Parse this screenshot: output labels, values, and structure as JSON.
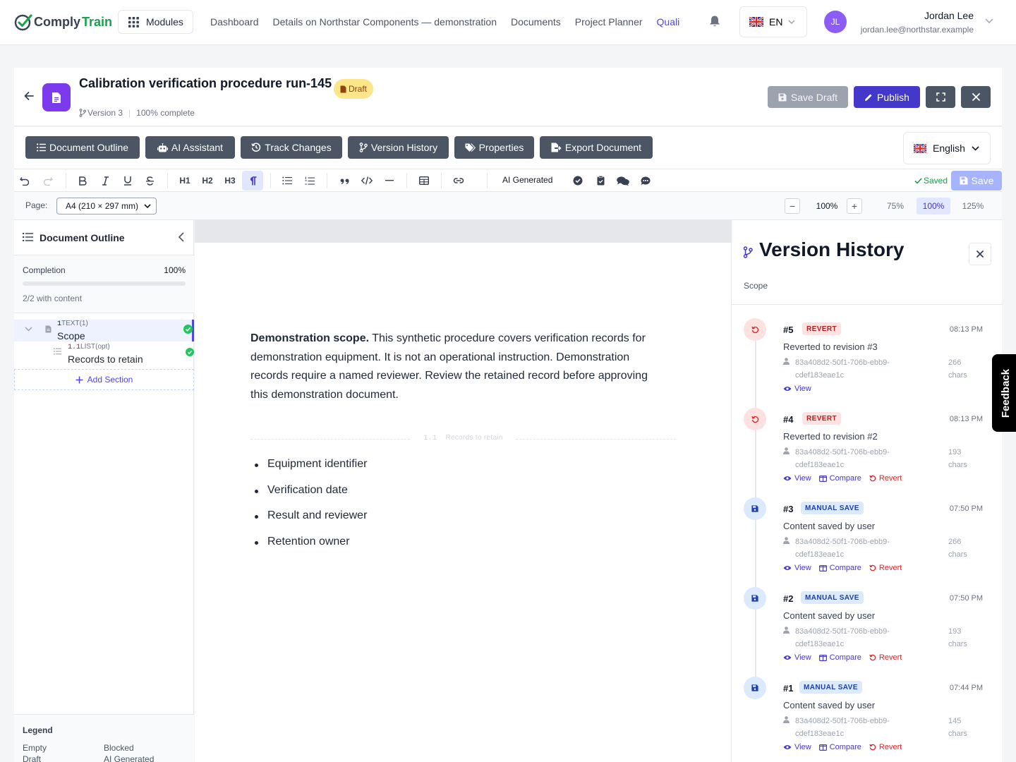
{
  "app": {
    "logo_comply": "Comply",
    "logo_train": "Train",
    "modules_label": "Modules",
    "nav_links": [
      "Dashboard",
      "Details on Northstar Components — demonstration",
      "Documents",
      "Project Planner",
      "Quali"
    ],
    "language_code": "EN"
  },
  "user": {
    "initials": "JL",
    "name": "Jordan Lee",
    "email": "jordan.lee@northstar.example"
  },
  "document": {
    "title": "Calibration verification procedure run-145",
    "status_badge": "Draft",
    "version": "Version 3",
    "completion_text": "100% complete",
    "save_draft_label": "Save Draft",
    "publish_label": "Publish"
  },
  "tool_tabs": [
    "Document Outline",
    "AI Assistant",
    "Track Changes",
    "Version History",
    "Properties",
    "Export Document"
  ],
  "language_select": "English",
  "format_toolbar": {
    "h1": "H1",
    "h2": "H2",
    "h3": "H3",
    "ai_generated_label": "AI Generated",
    "saved_status": "Saved",
    "save_label": "Save"
  },
  "page_settings": {
    "page_label": "Page:",
    "page_size": "A4 (210 × 297 mm)",
    "zoom_value": "100%",
    "zoom_presets": [
      "75%",
      "100%",
      "125%"
    ],
    "zoom_active": "100%"
  },
  "outline": {
    "title": "Document Outline",
    "completion_label": "Completion",
    "completion_value": "100%",
    "completion_fraction": 1.0,
    "with_content": "2/2 with content",
    "items": [
      {
        "number": "1",
        "type": "TEXT(1)",
        "label": "Scope"
      },
      {
        "number": "1.1",
        "type": "LIST(opt)",
        "label": "Records to retain"
      }
    ],
    "add_section_label": "Add Section",
    "legend_title": "Legend",
    "legend_items": [
      "Empty",
      "Blocked",
      "Draft",
      "AI Generated"
    ]
  },
  "content": {
    "scope_lead": "Demonstration scope.",
    "scope_text": " This synthetic procedure covers verification records for demonstration equipment. It is not an operational instruction. Demonstration records require a named reviewer. Review the retained record before approving this demonstration document.",
    "subsection_number": "1.1",
    "subsection_title": "Records to retain",
    "bullets": [
      "Equipment identifier",
      "Verification date",
      "Result and reviewer",
      "Retention owner"
    ]
  },
  "version_history": {
    "title": "Version History",
    "section": "Scope",
    "user_id_line1": "83a408d2-50f1-706b-ebb9-",
    "user_id_line2": "cdef183eae1c",
    "chars_unit": "chars",
    "action_view": "View",
    "action_compare": "Compare",
    "action_revert": "Revert",
    "revisions": [
      {
        "num": "#5",
        "badge": "REVERT",
        "time": "08:13 PM",
        "desc": "Reverted to revision #3",
        "chars": "266"
      },
      {
        "num": "#4",
        "badge": "REVERT",
        "time": "08:13 PM",
        "desc": "Reverted to revision #2",
        "chars": "193"
      },
      {
        "num": "#3",
        "badge": "MANUAL SAVE",
        "time": "07:50 PM",
        "desc": "Content saved by user",
        "chars": "266"
      },
      {
        "num": "#2",
        "badge": "MANUAL SAVE",
        "time": "07:50 PM",
        "desc": "Content saved by user",
        "chars": "193"
      },
      {
        "num": "#1",
        "badge": "MANUAL SAVE",
        "time": "07:44 PM",
        "desc": "Content saved by user",
        "chars": "145"
      }
    ]
  },
  "feedback_label": "Feedback",
  "colors": {
    "accent": "#4338ca",
    "brand_green": "#16a34a",
    "revert_red": "#dc2626",
    "draft_yellow": "#fde68a",
    "tab_gray": "#4b5563"
  }
}
